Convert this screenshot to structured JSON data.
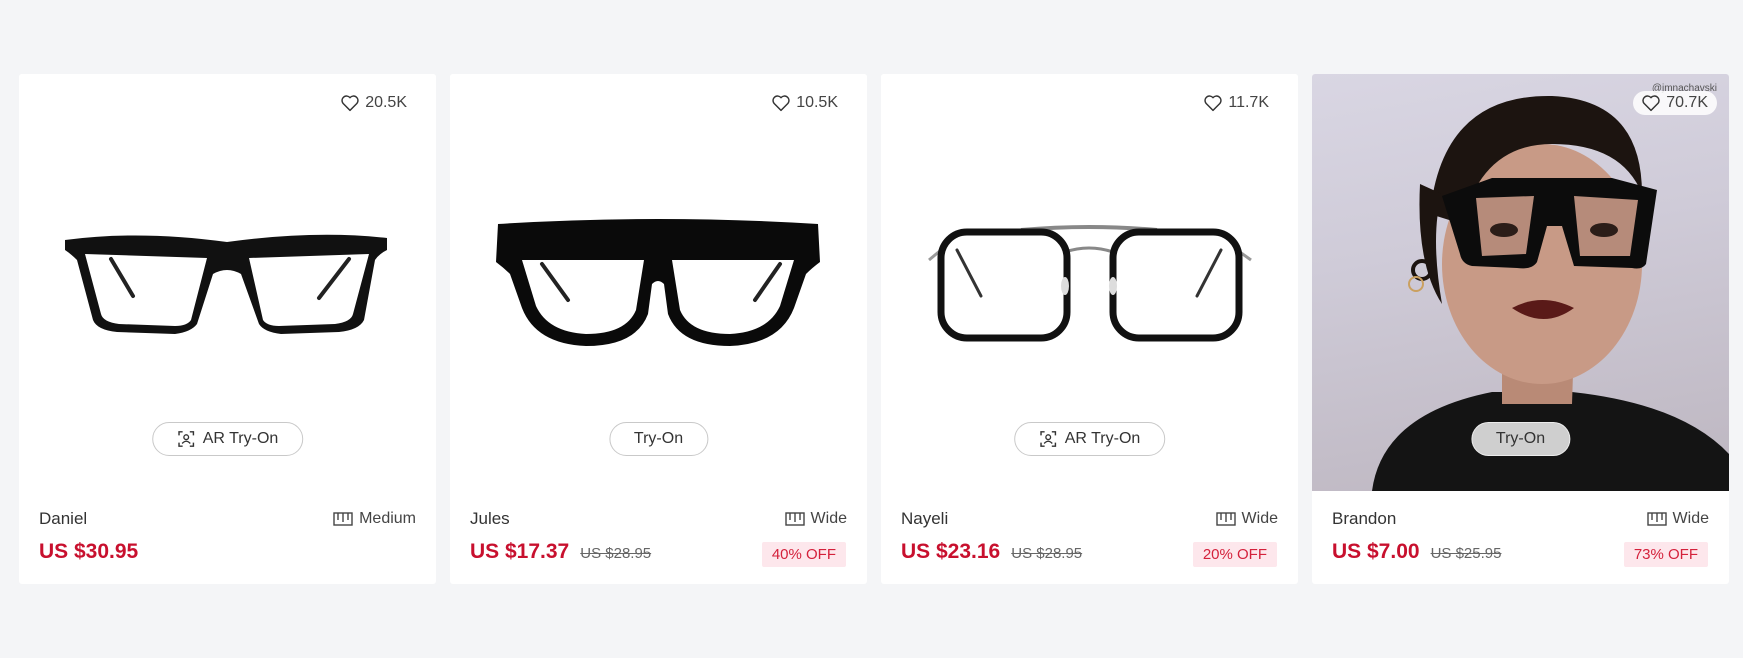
{
  "products": [
    {
      "name": "Daniel",
      "likes": "20.5K",
      "tryon_label": "AR Try-On",
      "fit_label": "Medium",
      "price": "US $30.95",
      "old_price": "",
      "discount": ""
    },
    {
      "name": "Jules",
      "likes": "10.5K",
      "tryon_label": "Try-On",
      "fit_label": "Wide",
      "price": "US $17.37",
      "old_price": "US $28.95",
      "discount": "40% OFF"
    },
    {
      "name": "Nayeli",
      "likes": "11.7K",
      "tryon_label": "AR Try-On",
      "fit_label": "Wide",
      "price": "US $23.16",
      "old_price": "US $28.95",
      "discount": "20% OFF"
    },
    {
      "name": "Brandon",
      "likes": "70.7K",
      "tryon_label": "Try-On",
      "fit_label": "Wide",
      "price": "US $7.00",
      "old_price": "US $25.95",
      "discount": "73% OFF",
      "photo_handle": "@jmnachavski"
    }
  ],
  "colors": {
    "price": "#c8102e",
    "discount_bg": "#fde7ec",
    "discount_text": "#d4213b",
    "page_bg": "#f4f5f7"
  },
  "icons": {
    "like": "heart-icon",
    "ar": "ar-scan-icon",
    "fit": "frame-width-icon"
  }
}
